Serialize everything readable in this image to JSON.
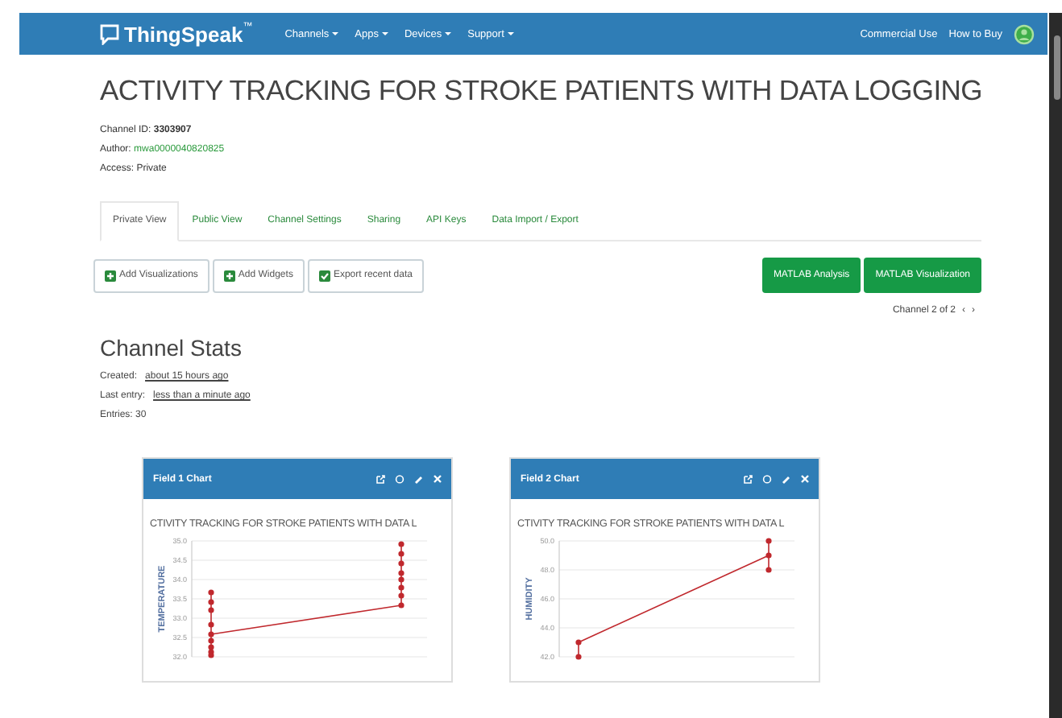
{
  "navbar": {
    "brand": "ThingSpeak",
    "trademark": "™",
    "menus": [
      {
        "label": "Channels"
      },
      {
        "label": "Apps"
      },
      {
        "label": "Devices"
      },
      {
        "label": "Support"
      }
    ],
    "links": [
      "Commercial Use",
      "How to Buy"
    ]
  },
  "channel": {
    "title": "ACTIVITY TRACKING FOR STROKE PATIENTS WITH DATA LOGGING",
    "id_label": "Channel ID:",
    "id": "3303907",
    "author_label": "Author:",
    "author": "mwa0000040820825",
    "access_label": "Access:",
    "access": "Private"
  },
  "tabs": [
    {
      "label": "Private View",
      "selected": true
    },
    {
      "label": "Public View",
      "selected": false
    },
    {
      "label": "Channel Settings",
      "selected": false
    },
    {
      "label": "Sharing",
      "selected": false
    },
    {
      "label": "API Keys",
      "selected": false
    },
    {
      "label": "Data Import / Export",
      "selected": false
    }
  ],
  "toolbar": {
    "left_buttons": [
      {
        "label": "Add Visualizations",
        "kind": "add"
      },
      {
        "label": "Add Widgets",
        "kind": "add"
      },
      {
        "label": "Export recent data",
        "kind": "export"
      }
    ],
    "right_buttons": [
      "MATLAB Analysis",
      "MATLAB Visualization"
    ],
    "pager": "Channel 2 of 2",
    "prev": "‹",
    "next": "›"
  },
  "stats": {
    "heading": "Channel Stats",
    "created_label": "Created:",
    "created": "about 15 hours ago",
    "last_entry_label": "Last entry:",
    "last_entry": "less than a minute ago",
    "entries": "Entries: 30"
  },
  "charts": [
    {
      "header": "Field 1 Chart",
      "title": "CTIVITY TRACKING FOR STROKE PATIENTS WITH DATA L",
      "ylabel": "TEMPERATURE",
      "y_labels": [
        "35.0",
        "34.5",
        "34.0",
        "33.5",
        "33.0",
        "32.5",
        "32.0"
      ]
    },
    {
      "header": "Field 2 Chart",
      "title": "CTIVITY TRACKING FOR STROKE PATIENTS WITH DATA L",
      "ylabel": "HUMIDITY",
      "y_labels": [
        "50.0",
        "48.0",
        "46.0",
        "44.0",
        "42.0"
      ]
    }
  ]
}
